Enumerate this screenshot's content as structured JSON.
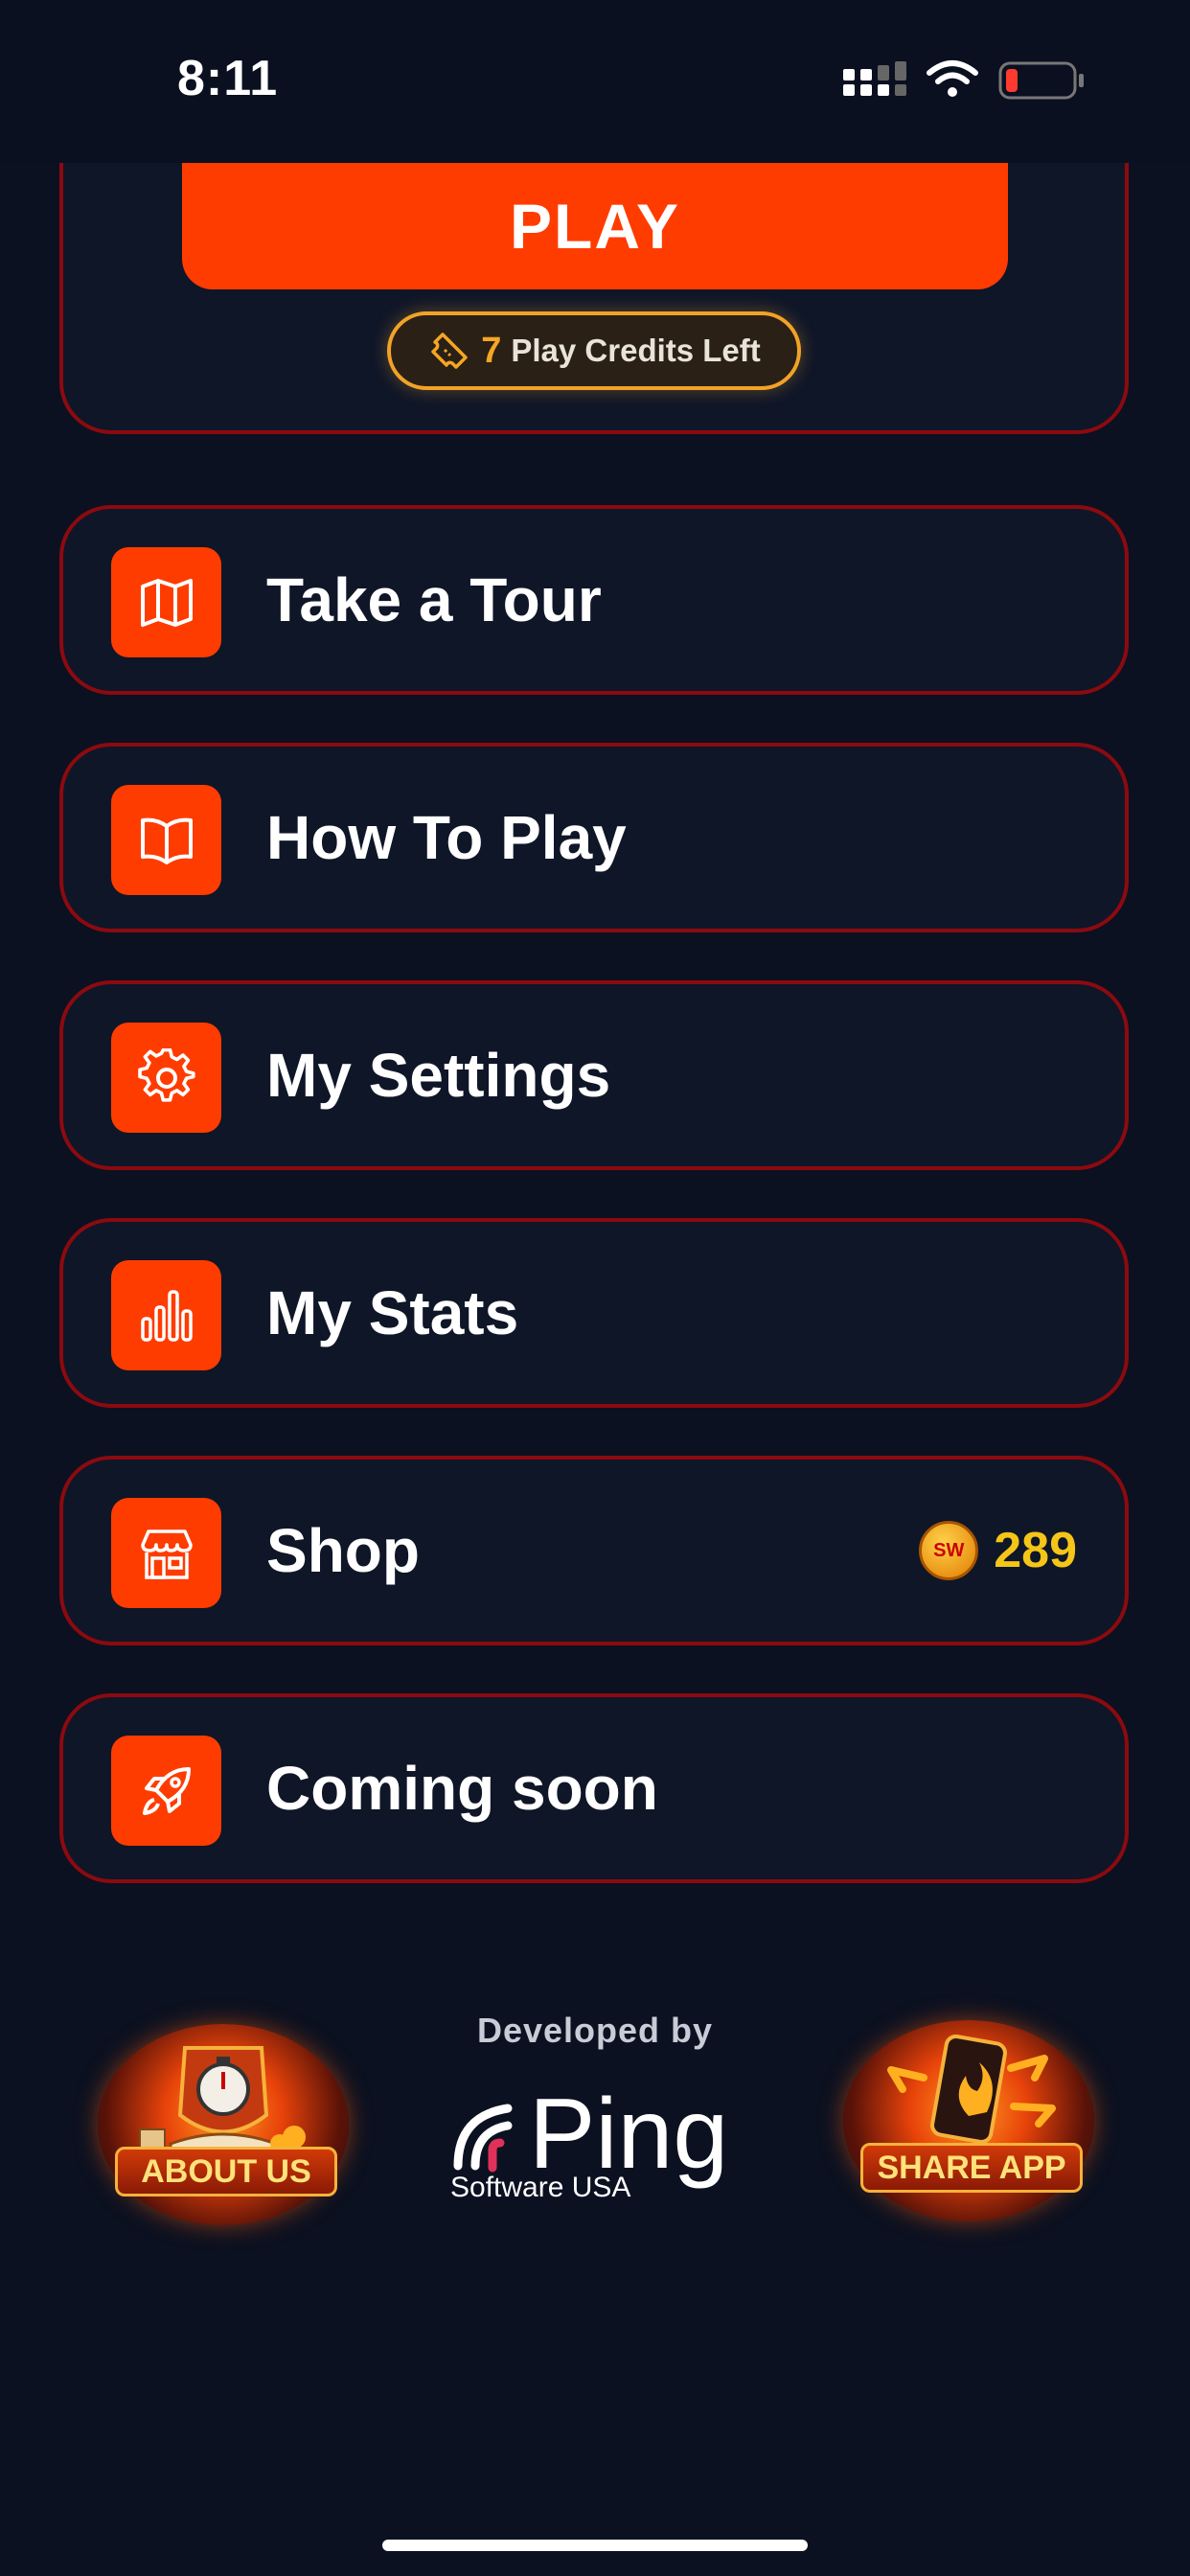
{
  "status": {
    "time": "8:11"
  },
  "play": {
    "label": "PLAY",
    "credits_count": "7",
    "credits_text": "Play Credits Left"
  },
  "menu": {
    "items": [
      {
        "label": "Take a Tour",
        "icon": "map-icon"
      },
      {
        "label": "How To Play",
        "icon": "book-icon"
      },
      {
        "label": "My Settings",
        "icon": "gear-icon"
      },
      {
        "label": "My Stats",
        "icon": "stats-icon"
      },
      {
        "label": "Shop",
        "icon": "store-icon",
        "coin_label": "SW",
        "coins": "289"
      },
      {
        "label": "Coming soon",
        "icon": "rocket-icon"
      }
    ]
  },
  "footer": {
    "developed_by": "Developed by",
    "brand": "Ping",
    "brand_sub": "Software USA",
    "about_label": "ABOUT US",
    "share_label": "SHARE APP"
  },
  "colors": {
    "accent": "#ff3c00",
    "border": "#8c0a0f",
    "bg": "#0b1120",
    "coin": "#f5c518"
  }
}
